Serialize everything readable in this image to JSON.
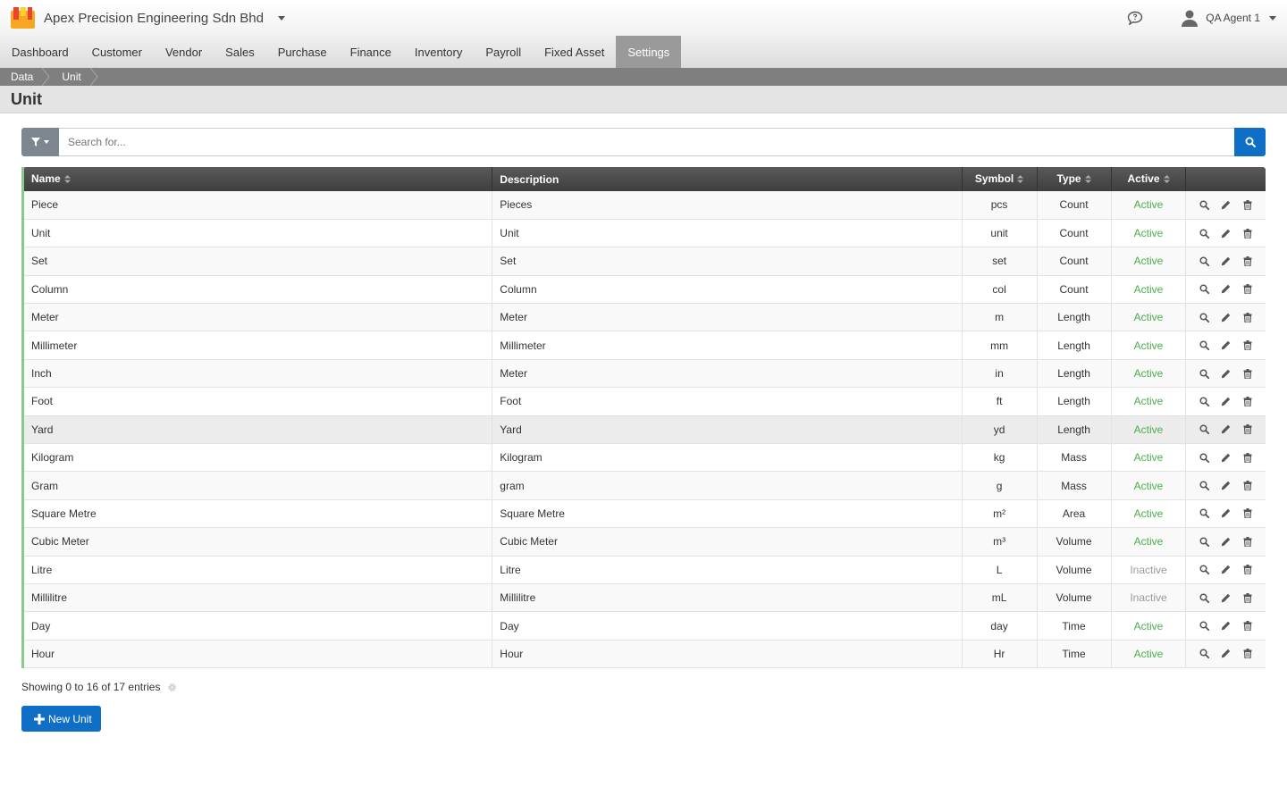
{
  "header": {
    "company": "Apex Precision Engineering Sdn Bhd",
    "user": "QA Agent 1"
  },
  "nav": {
    "items": [
      "Dashboard",
      "Customer",
      "Vendor",
      "Sales",
      "Purchase",
      "Finance",
      "Inventory",
      "Payroll",
      "Fixed Asset",
      "Settings"
    ],
    "active": "Settings"
  },
  "breadcrumb": [
    "Data",
    "Unit"
  ],
  "page": {
    "title": "Unit"
  },
  "search": {
    "placeholder": "Search for..."
  },
  "table": {
    "columns": {
      "name": "Name",
      "description": "Description",
      "symbol": "Symbol",
      "type": "Type",
      "active": "Active"
    },
    "rows": [
      {
        "name": "Piece",
        "description": "Pieces",
        "symbol": "pcs",
        "type": "Count",
        "active": "Active"
      },
      {
        "name": "Unit",
        "description": "Unit",
        "symbol": "unit",
        "type": "Count",
        "active": "Active"
      },
      {
        "name": "Set",
        "description": "Set",
        "symbol": "set",
        "type": "Count",
        "active": "Active"
      },
      {
        "name": "Column",
        "description": "Column",
        "symbol": "col",
        "type": "Count",
        "active": "Active"
      },
      {
        "name": "Meter",
        "description": "Meter",
        "symbol": "m",
        "type": "Length",
        "active": "Active"
      },
      {
        "name": "Millimeter",
        "description": "Millimeter",
        "symbol": "mm",
        "type": "Length",
        "active": "Active"
      },
      {
        "name": "Inch",
        "description": "Meter",
        "symbol": "in",
        "type": "Length",
        "active": "Active"
      },
      {
        "name": "Foot",
        "description": "Foot",
        "symbol": "ft",
        "type": "Length",
        "active": "Active"
      },
      {
        "name": "Yard",
        "description": "Yard",
        "symbol": "yd",
        "type": "Length",
        "active": "Active"
      },
      {
        "name": "Kilogram",
        "description": "Kilogram",
        "symbol": "kg",
        "type": "Mass",
        "active": "Active"
      },
      {
        "name": "Gram",
        "description": "gram",
        "symbol": "g",
        "type": "Mass",
        "active": "Active"
      },
      {
        "name": "Square Metre",
        "description": "Square Metre",
        "symbol": "m²",
        "type": "Area",
        "active": "Active"
      },
      {
        "name": "Cubic Meter",
        "description": "Cubic Meter",
        "symbol": "m³",
        "type": "Volume",
        "active": "Active"
      },
      {
        "name": "Litre",
        "description": "Litre",
        "symbol": "L",
        "type": "Volume",
        "active": "Inactive"
      },
      {
        "name": "Millilitre",
        "description": "Millilitre",
        "symbol": "mL",
        "type": "Volume",
        "active": "Inactive"
      },
      {
        "name": "Day",
        "description": "Day",
        "symbol": "day",
        "type": "Time",
        "active": "Active"
      },
      {
        "name": "Hour",
        "description": "Hour",
        "symbol": "Hr",
        "type": "Time",
        "active": "Active"
      }
    ],
    "hover_row": 8
  },
  "footer": {
    "showing": "Showing 0 to 16 of 17 entries",
    "new_button": "New Unit"
  },
  "colors": {
    "accent": "#0f6fc6",
    "active": "#4cae4c",
    "inactive": "#999999",
    "nav_active": "#9a9a9a"
  },
  "icons": [
    "chat-icon",
    "user-icon",
    "filter-icon",
    "search-icon",
    "view-icon",
    "edit-icon",
    "delete-icon",
    "gear-icon",
    "plus-icon"
  ]
}
